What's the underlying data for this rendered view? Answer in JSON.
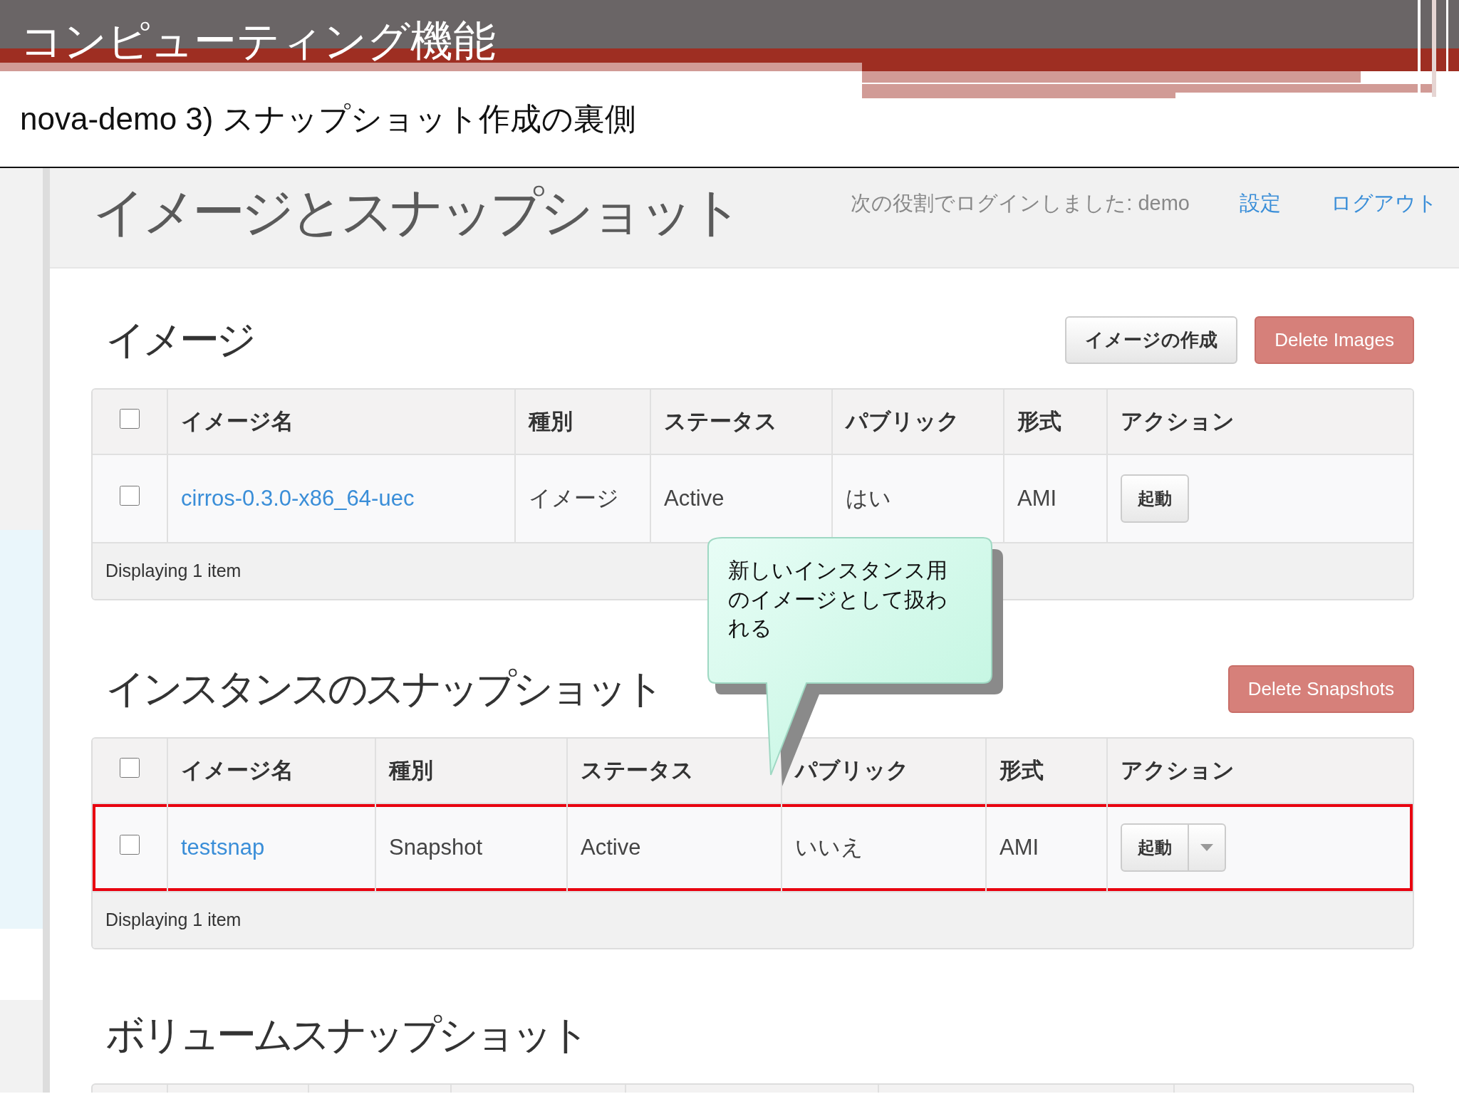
{
  "slide": {
    "title": "コンピューティング機能",
    "subtitle": "nova-demo 3) スナップショット作成の裏側"
  },
  "header": {
    "title": "イメージとスナップショット",
    "login_text": "次の役割でログインしました: demo",
    "links": [
      "設定",
      "ログアウト"
    ]
  },
  "sections": [
    {
      "title": "イメージ",
      "buttons": [
        {
          "label": "イメージの作成",
          "kind": "default"
        },
        {
          "label": "Delete Images",
          "kind": "danger"
        }
      ],
      "table": {
        "kind": "full",
        "header_checked": false,
        "columns": [
          "イメージ名",
          "種別",
          "ステータス",
          "パブリック",
          "形式",
          "アクション"
        ],
        "rows": [
          {
            "checked": false,
            "highlighted": false,
            "cells": [
              "cirros-0.3.0-x86_64-uec",
              "イメージ",
              "Active",
              "はい",
              "AMI"
            ],
            "action": {
              "label": "起動",
              "dropdown": false
            }
          }
        ],
        "footer": "Displaying 1 item"
      }
    },
    {
      "title": "インスタンスのスナップショット",
      "buttons": [
        {
          "label": "Delete Snapshots",
          "kind": "danger"
        }
      ],
      "table": {
        "kind": "full",
        "header_checked": false,
        "columns": [
          "イメージ名",
          "種別",
          "ステータス",
          "パブリック",
          "形式",
          "アクション"
        ],
        "rows": [
          {
            "checked": false,
            "highlighted": true,
            "cells": [
              "testsnap",
              "Snapshot",
              "Active",
              "いいえ",
              "AMI"
            ],
            "action": {
              "label": "起動",
              "dropdown": true
            }
          }
        ],
        "footer": "Displaying 1 item"
      }
    },
    {
      "title": "ボリュームスナップショット",
      "table": {
        "kind": "partial"
      }
    }
  ],
  "callout": {
    "text": "新しいインスタンス用のイメージとして扱われる"
  }
}
